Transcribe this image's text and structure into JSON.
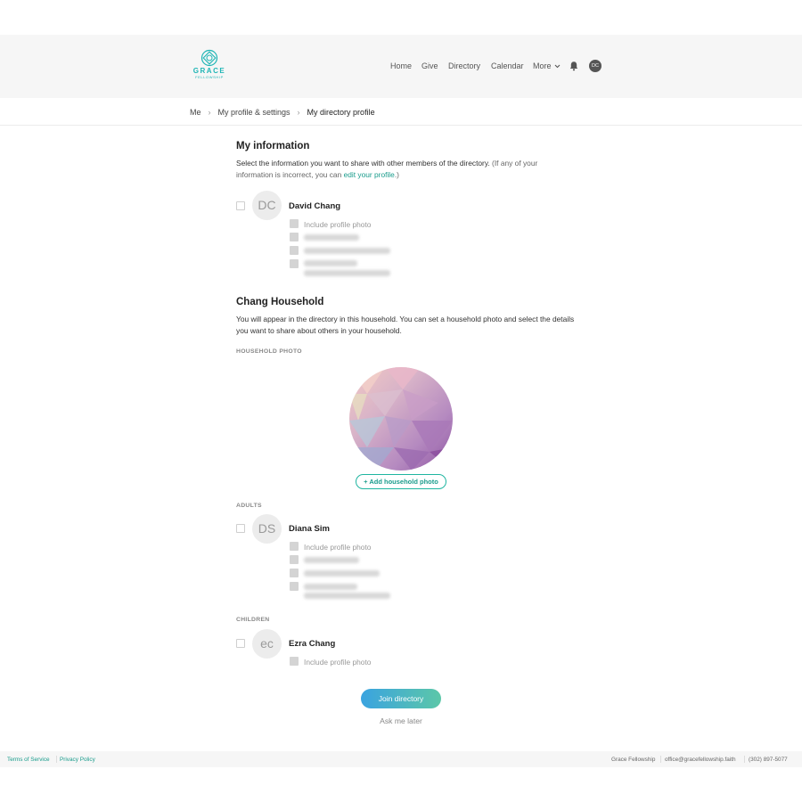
{
  "brand": {
    "name": "GRACE",
    "subtitle": "FELLOWSHIP",
    "color": "#1fb5b5"
  },
  "nav": {
    "items": [
      "Home",
      "Give",
      "Directory",
      "Calendar"
    ],
    "more": "More",
    "bell_icon": "bell-icon",
    "avatar_initials": "DC"
  },
  "breadcrumb": [
    "Me",
    "My profile & settings",
    "My directory profile"
  ],
  "my_info": {
    "title": "My information",
    "desc": "Select the information you want to share with other members of the directory.",
    "desc_muted_pre": " (If any of your information is incorrect, you can ",
    "link": "edit your profile",
    "desc_muted_post": ".)",
    "person": {
      "initials": "DC",
      "name": "David Chang",
      "photo_label": "Include profile photo"
    }
  },
  "household": {
    "title": "Chang Household",
    "desc": "You will appear in the directory in this household. You can set a household photo and select the details you want to share about others in your household.",
    "photo_label": "HOUSEHOLD PHOTO",
    "add_photo": "+ Add household photo",
    "adults_label": "ADULTS",
    "adult": {
      "initials": "DS",
      "name": "Diana Sim",
      "photo_label": "Include profile photo"
    },
    "children_label": "CHILDREN",
    "child": {
      "initials": "ec",
      "name": "Ezra Chang",
      "photo_label": "Include profile photo"
    }
  },
  "actions": {
    "join": "Join directory",
    "later": "Ask me later"
  },
  "footer": {
    "terms": "Terms of Service",
    "privacy": "Privacy Policy",
    "org": "Grace Fellowship",
    "email": "office@gracefellowship.faith",
    "phone": "(302) 897-5077"
  },
  "colors": {
    "accent": "#1a9c8c",
    "join_start": "#3aa3e0",
    "join_end": "#5cc7a8"
  }
}
